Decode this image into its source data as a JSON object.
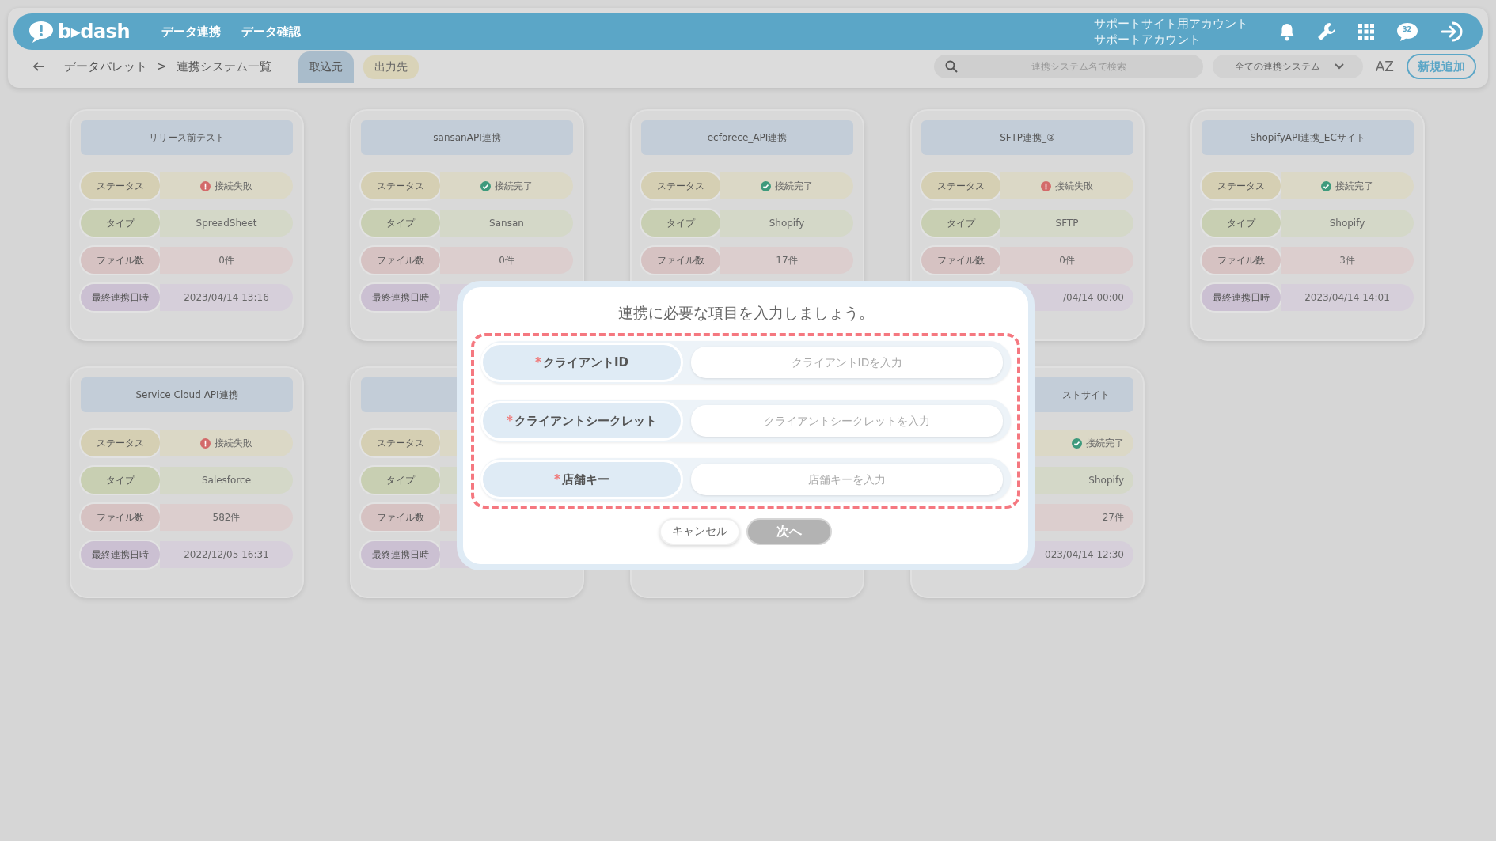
{
  "header": {
    "logo": "b▸dash",
    "nav": [
      "データ連携",
      "データ確認"
    ],
    "account": [
      "サポートサイト用アカウント",
      "サポートアカウント"
    ],
    "chat_badge": "32"
  },
  "toolbar": {
    "breadcrumb": [
      "データパレット",
      ">",
      "連携システム一覧"
    ],
    "tabs": [
      {
        "label": "取込元",
        "selected": true
      },
      {
        "label": "出力先",
        "selected": false
      }
    ],
    "search": {
      "placeholder": "連携システム名で検索"
    },
    "filter": "全ての連携システム",
    "sort_label": "AZ",
    "add_button": "新規追加"
  },
  "cards": [
    {
      "kind": "card",
      "title": "リリース前テスト",
      "rows": [
        {
          "kind": "status",
          "label": "ステータス",
          "value": "接続失敗",
          "connected": false
        },
        {
          "kind": "type",
          "label": "タイプ",
          "value": "SpreadSheet"
        },
        {
          "kind": "files",
          "label": "ファイル数",
          "value": "0件"
        },
        {
          "kind": "date",
          "label": "最終連携日時",
          "value": "2023/04/14 13:16"
        }
      ]
    },
    {
      "kind": "card",
      "title": "sansanAPI連携",
      "rows": [
        {
          "kind": "status",
          "label": "ステータス",
          "value": "接続完了",
          "connected": true
        },
        {
          "kind": "type",
          "label": "タイプ",
          "value": "Sansan"
        },
        {
          "kind": "files",
          "label": "ファイル数",
          "value": "0件"
        },
        {
          "kind": "date",
          "label": "最終連携日時"
        }
      ]
    },
    {
      "kind": "card",
      "title": "ecforece_API連携",
      "rows": [
        {
          "kind": "status",
          "label": "ステータス",
          "value": "接続完了",
          "connected": true
        },
        {
          "kind": "type",
          "label": "タイプ",
          "value": "Shopify"
        },
        {
          "kind": "files",
          "label": "ファイル数",
          "value": "17件"
        }
      ]
    },
    {
      "kind": "card",
      "title": "SFTP連携_②",
      "rows": [
        {
          "kind": "status",
          "label": "ステータス",
          "value": "接続失敗",
          "connected": false
        },
        {
          "kind": "type",
          "label": "タイプ",
          "value": "SFTP"
        },
        {
          "kind": "files",
          "label": "ファイル数",
          "value": "0件"
        },
        {
          "kind": "date",
          "value": "/04/14 00:00"
        }
      ]
    },
    {
      "kind": "card",
      "title": "ShopifyAPI連携_ECサイト",
      "rows": [
        {
          "kind": "status",
          "label": "ステータス",
          "value": "接続完了",
          "connected": true
        },
        {
          "kind": "type",
          "label": "タイプ",
          "value": "Shopify"
        },
        {
          "kind": "files",
          "label": "ファイル数",
          "value": "3件"
        },
        {
          "kind": "date",
          "label": "最終連携日時",
          "value": "2023/04/14 14:01"
        }
      ]
    },
    {
      "kind": "card",
      "title": "Service Cloud API連携",
      "rows": [
        {
          "kind": "status",
          "label": "ステータス",
          "value": "接続失敗",
          "connected": false
        },
        {
          "kind": "type",
          "label": "タイプ",
          "value": "Salesforce"
        },
        {
          "kind": "files",
          "label": "ファイル数",
          "value": "582件"
        },
        {
          "kind": "date",
          "label": "最終連携日時",
          "value": "2022/12/05 16:31"
        }
      ]
    },
    {
      "kind": "card",
      "rows": [
        {
          "kind": "status",
          "label": "ステータス"
        },
        {
          "kind": "type",
          "label": "タイプ"
        },
        {
          "kind": "files",
          "label": "ファイル数"
        },
        {
          "kind": "date",
          "label": "最終連携日時"
        }
      ]
    },
    {
      "kind": "card"
    },
    {
      "kind": "card",
      "title": "ストサイト",
      "rows": [
        {
          "kind": "status",
          "value": "接続完了",
          "connected": true
        },
        {
          "kind": "type",
          "value": "Shopify"
        },
        {
          "kind": "files",
          "value": "27件"
        },
        {
          "kind": "date",
          "value": "023/04/14 12:30"
        }
      ]
    }
  ],
  "dialog": {
    "title": "連携に必要な項目を入力しましょう。",
    "required_mark": "*",
    "fields": [
      {
        "label": "クライアントID",
        "required": true,
        "placeholder": "クライアントIDを入力"
      },
      {
        "label": "クライアントシークレット",
        "required": true,
        "placeholder": "クライアントシークレットを入力"
      },
      {
        "label": "店舗キー",
        "required": true,
        "placeholder": "店舗キーを入力"
      }
    ],
    "buttons": [
      {
        "label": "キャンセル",
        "disabled": false
      },
      {
        "label": "次へ",
        "disabled": true
      }
    ]
  }
}
